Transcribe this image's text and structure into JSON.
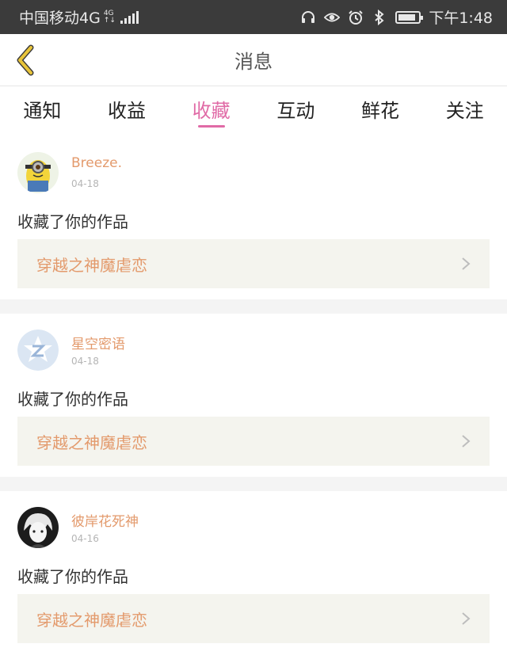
{
  "status_bar": {
    "carrier": "中国移动4G",
    "network_small_top": "4G",
    "network_small_bottom": "↑↓",
    "time": "下午1:48",
    "icons": [
      "headphones-icon",
      "eye-icon",
      "alarm-icon",
      "bluetooth-icon",
      "battery-icon"
    ],
    "battery_level": 0.85
  },
  "header": {
    "title": "消息",
    "back_icon": "chevron-left-icon",
    "back_color": "#e8c43a"
  },
  "tabs": [
    {
      "label": "通知",
      "active": false
    },
    {
      "label": "收益",
      "active": false
    },
    {
      "label": "收藏",
      "active": true
    },
    {
      "label": "互动",
      "active": false
    },
    {
      "label": "鲜花",
      "active": false
    },
    {
      "label": "关注",
      "active": false
    }
  ],
  "accent_color": "#e06aa6",
  "items": [
    {
      "user": "Breeze.",
      "date": "04-18",
      "action": "收藏了你的作品",
      "work": "穿越之神魔虐恋",
      "avatar": "minion-avatar"
    },
    {
      "user": "星空密语",
      "date": "04-18",
      "action": "收藏了你的作品",
      "work": "穿越之神魔虐恋",
      "avatar": "default-z-avatar"
    },
    {
      "user": "彼岸花死神",
      "date": "04-16",
      "action": "收藏了你的作品",
      "work": "穿越之神魔虐恋",
      "avatar": "anime-boy-avatar"
    }
  ]
}
